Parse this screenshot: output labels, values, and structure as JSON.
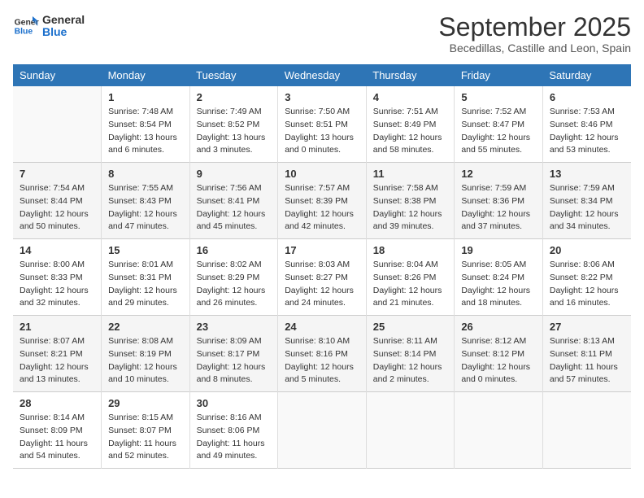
{
  "header": {
    "logo_general": "General",
    "logo_blue": "Blue",
    "month_title": "September 2025",
    "location": "Becedillas, Castille and Leon, Spain"
  },
  "days_of_week": [
    "Sunday",
    "Monday",
    "Tuesday",
    "Wednesday",
    "Thursday",
    "Friday",
    "Saturday"
  ],
  "weeks": [
    [
      {
        "day": "",
        "info": ""
      },
      {
        "day": "1",
        "info": "Sunrise: 7:48 AM\nSunset: 8:54 PM\nDaylight: 13 hours\nand 6 minutes."
      },
      {
        "day": "2",
        "info": "Sunrise: 7:49 AM\nSunset: 8:52 PM\nDaylight: 13 hours\nand 3 minutes."
      },
      {
        "day": "3",
        "info": "Sunrise: 7:50 AM\nSunset: 8:51 PM\nDaylight: 13 hours\nand 0 minutes."
      },
      {
        "day": "4",
        "info": "Sunrise: 7:51 AM\nSunset: 8:49 PM\nDaylight: 12 hours\nand 58 minutes."
      },
      {
        "day": "5",
        "info": "Sunrise: 7:52 AM\nSunset: 8:47 PM\nDaylight: 12 hours\nand 55 minutes."
      },
      {
        "day": "6",
        "info": "Sunrise: 7:53 AM\nSunset: 8:46 PM\nDaylight: 12 hours\nand 53 minutes."
      }
    ],
    [
      {
        "day": "7",
        "info": "Sunrise: 7:54 AM\nSunset: 8:44 PM\nDaylight: 12 hours\nand 50 minutes."
      },
      {
        "day": "8",
        "info": "Sunrise: 7:55 AM\nSunset: 8:43 PM\nDaylight: 12 hours\nand 47 minutes."
      },
      {
        "day": "9",
        "info": "Sunrise: 7:56 AM\nSunset: 8:41 PM\nDaylight: 12 hours\nand 45 minutes."
      },
      {
        "day": "10",
        "info": "Sunrise: 7:57 AM\nSunset: 8:39 PM\nDaylight: 12 hours\nand 42 minutes."
      },
      {
        "day": "11",
        "info": "Sunrise: 7:58 AM\nSunset: 8:38 PM\nDaylight: 12 hours\nand 39 minutes."
      },
      {
        "day": "12",
        "info": "Sunrise: 7:59 AM\nSunset: 8:36 PM\nDaylight: 12 hours\nand 37 minutes."
      },
      {
        "day": "13",
        "info": "Sunrise: 7:59 AM\nSunset: 8:34 PM\nDaylight: 12 hours\nand 34 minutes."
      }
    ],
    [
      {
        "day": "14",
        "info": "Sunrise: 8:00 AM\nSunset: 8:33 PM\nDaylight: 12 hours\nand 32 minutes."
      },
      {
        "day": "15",
        "info": "Sunrise: 8:01 AM\nSunset: 8:31 PM\nDaylight: 12 hours\nand 29 minutes."
      },
      {
        "day": "16",
        "info": "Sunrise: 8:02 AM\nSunset: 8:29 PM\nDaylight: 12 hours\nand 26 minutes."
      },
      {
        "day": "17",
        "info": "Sunrise: 8:03 AM\nSunset: 8:27 PM\nDaylight: 12 hours\nand 24 minutes."
      },
      {
        "day": "18",
        "info": "Sunrise: 8:04 AM\nSunset: 8:26 PM\nDaylight: 12 hours\nand 21 minutes."
      },
      {
        "day": "19",
        "info": "Sunrise: 8:05 AM\nSunset: 8:24 PM\nDaylight: 12 hours\nand 18 minutes."
      },
      {
        "day": "20",
        "info": "Sunrise: 8:06 AM\nSunset: 8:22 PM\nDaylight: 12 hours\nand 16 minutes."
      }
    ],
    [
      {
        "day": "21",
        "info": "Sunrise: 8:07 AM\nSunset: 8:21 PM\nDaylight: 12 hours\nand 13 minutes."
      },
      {
        "day": "22",
        "info": "Sunrise: 8:08 AM\nSunset: 8:19 PM\nDaylight: 12 hours\nand 10 minutes."
      },
      {
        "day": "23",
        "info": "Sunrise: 8:09 AM\nSunset: 8:17 PM\nDaylight: 12 hours\nand 8 minutes."
      },
      {
        "day": "24",
        "info": "Sunrise: 8:10 AM\nSunset: 8:16 PM\nDaylight: 12 hours\nand 5 minutes."
      },
      {
        "day": "25",
        "info": "Sunrise: 8:11 AM\nSunset: 8:14 PM\nDaylight: 12 hours\nand 2 minutes."
      },
      {
        "day": "26",
        "info": "Sunrise: 8:12 AM\nSunset: 8:12 PM\nDaylight: 12 hours\nand 0 minutes."
      },
      {
        "day": "27",
        "info": "Sunrise: 8:13 AM\nSunset: 8:11 PM\nDaylight: 11 hours\nand 57 minutes."
      }
    ],
    [
      {
        "day": "28",
        "info": "Sunrise: 8:14 AM\nSunset: 8:09 PM\nDaylight: 11 hours\nand 54 minutes."
      },
      {
        "day": "29",
        "info": "Sunrise: 8:15 AM\nSunset: 8:07 PM\nDaylight: 11 hours\nand 52 minutes."
      },
      {
        "day": "30",
        "info": "Sunrise: 8:16 AM\nSunset: 8:06 PM\nDaylight: 11 hours\nand 49 minutes."
      },
      {
        "day": "",
        "info": ""
      },
      {
        "day": "",
        "info": ""
      },
      {
        "day": "",
        "info": ""
      },
      {
        "day": "",
        "info": ""
      }
    ]
  ]
}
